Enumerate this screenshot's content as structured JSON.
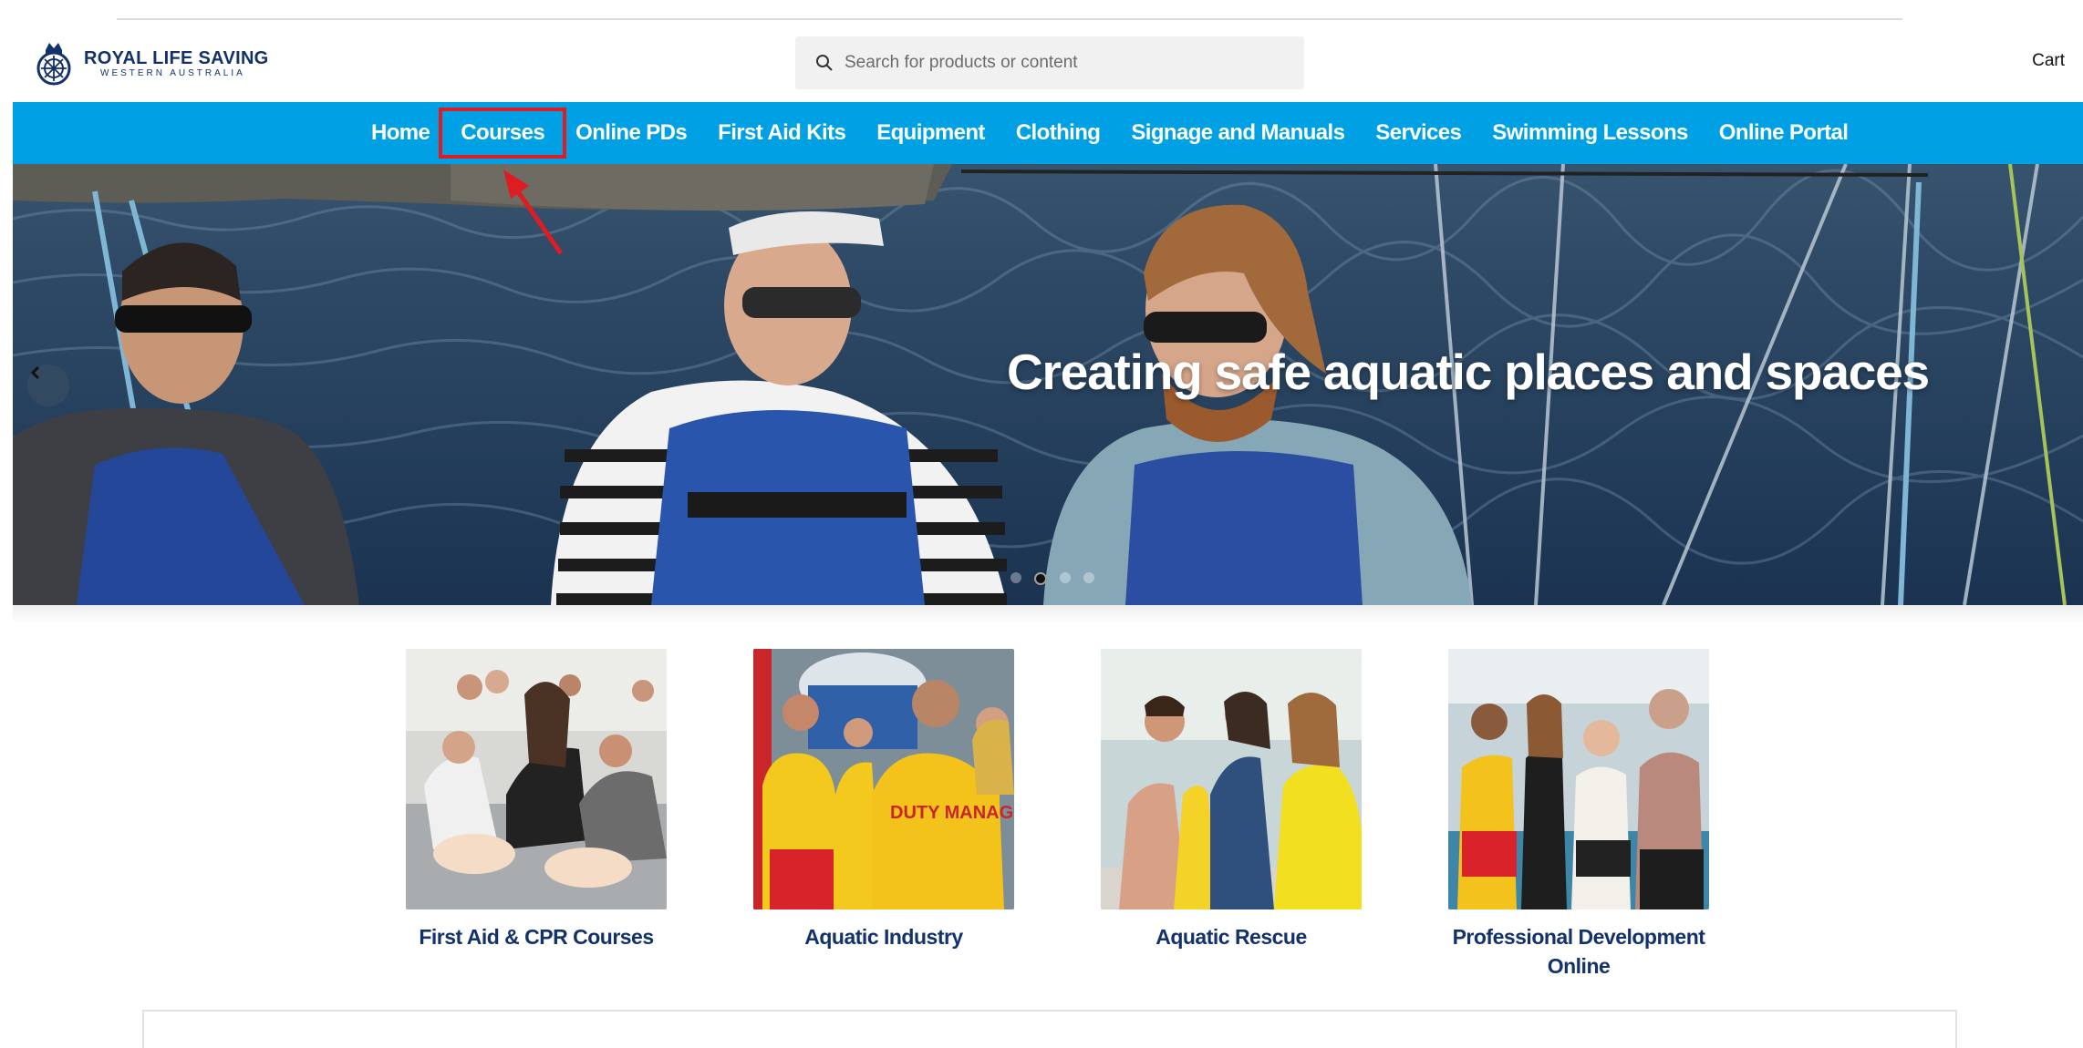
{
  "header": {
    "logo_name": "ROYAL LIFE SAVING",
    "logo_sub": "WESTERN AUSTRALIA",
    "search_placeholder": "Search for products or content",
    "cart_label": "Cart"
  },
  "nav": {
    "items": [
      {
        "label": "Home"
      },
      {
        "label": "Courses",
        "highlighted": true
      },
      {
        "label": "Online PDs"
      },
      {
        "label": "First Aid Kits"
      },
      {
        "label": "Equipment"
      },
      {
        "label": "Clothing"
      },
      {
        "label": "Signage and Manuals"
      },
      {
        "label": "Services"
      },
      {
        "label": "Swimming Lessons"
      },
      {
        "label": "Online Portal"
      }
    ]
  },
  "hero": {
    "caption": "Creating safe aquatic places and spaces",
    "slides": 4,
    "active_slide": 2
  },
  "categories": [
    {
      "label": "First Aid & CPR Courses"
    },
    {
      "label": "Aquatic Industry"
    },
    {
      "label": "Aquatic Rescue"
    },
    {
      "label": "Professional Development Online"
    }
  ],
  "colors": {
    "nav_bg": "#00a1e4",
    "brand_navy": "#13316b",
    "annotation_red": "#e01b22"
  },
  "icons": {
    "search": "search-icon",
    "prev": "chevron-left-icon",
    "logo": "crest-icon"
  }
}
